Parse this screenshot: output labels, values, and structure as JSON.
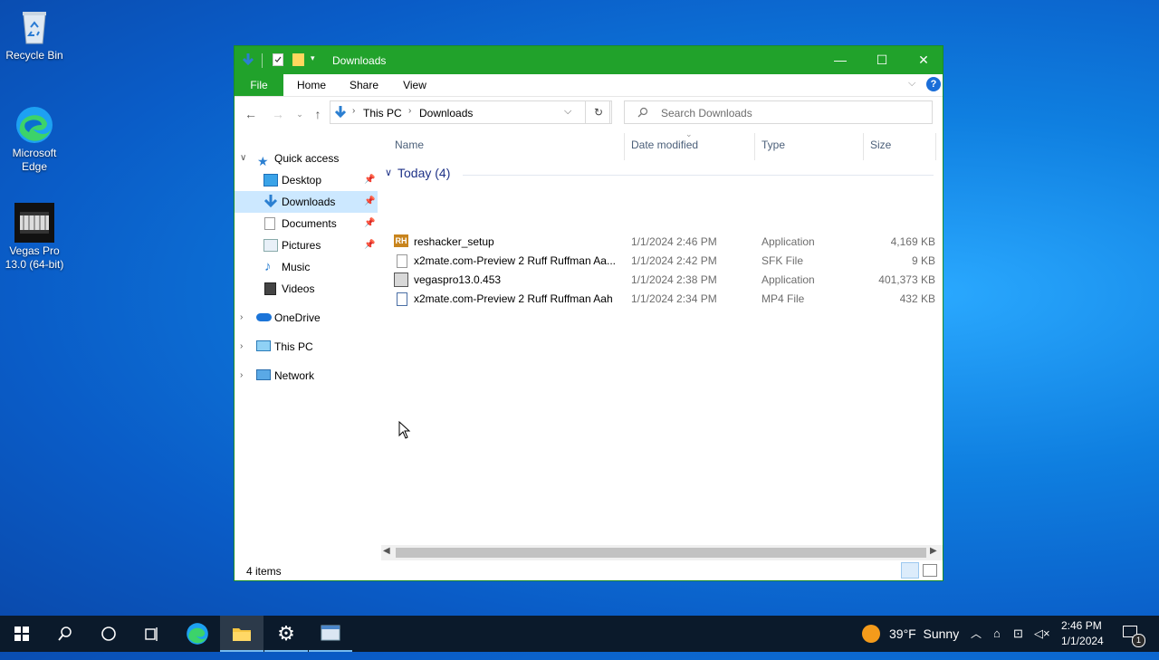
{
  "desktop": {
    "icons": [
      {
        "label": "Recycle Bin"
      },
      {
        "label": "Microsoft Edge"
      },
      {
        "label": "Vegas Pro 13.0 (64-bit)"
      }
    ]
  },
  "window": {
    "title": "Downloads",
    "ribbon_tabs": [
      "File",
      "Home",
      "Share",
      "View"
    ],
    "breadcrumb": [
      "This PC",
      "Downloads"
    ],
    "search_placeholder": "Search Downloads",
    "nav": {
      "quick_access": "Quick access",
      "items": [
        {
          "label": "Desktop",
          "pinned": true
        },
        {
          "label": "Downloads",
          "pinned": true,
          "selected": true
        },
        {
          "label": "Documents",
          "pinned": true
        },
        {
          "label": "Pictures",
          "pinned": true
        },
        {
          "label": "Music",
          "pinned": false
        },
        {
          "label": "Videos",
          "pinned": false
        }
      ],
      "roots": [
        "OneDrive",
        "This PC",
        "Network"
      ]
    },
    "columns": [
      "Name",
      "Date modified",
      "Type",
      "Size"
    ],
    "group_label": "Today (4)",
    "files": [
      {
        "name": "reshacker_setup",
        "date": "1/1/2024 2:46 PM",
        "type": "Application",
        "size": "4,169 KB",
        "icon": "app-icon"
      },
      {
        "name": "x2mate.com-Preview 2 Ruff Ruffman Aa...",
        "date": "1/1/2024 2:42 PM",
        "type": "SFK File",
        "size": "9 KB",
        "icon": "blank-file-icon"
      },
      {
        "name": "vegaspro13.0.453",
        "date": "1/1/2024 2:38 PM",
        "type": "Application",
        "size": "401,373 KB",
        "icon": "installer-icon"
      },
      {
        "name": "x2mate.com-Preview 2 Ruff Ruffman Aah",
        "date": "1/1/2024 2:34 PM",
        "type": "MP4 File",
        "size": "432 KB",
        "icon": "video-file-icon"
      }
    ],
    "status": "4 items",
    "accent": "#21a22b"
  },
  "taskbar": {
    "weather": "39°F  Sunny",
    "time": "2:46 PM",
    "date": "1/1/2024",
    "notification_count": "1"
  }
}
